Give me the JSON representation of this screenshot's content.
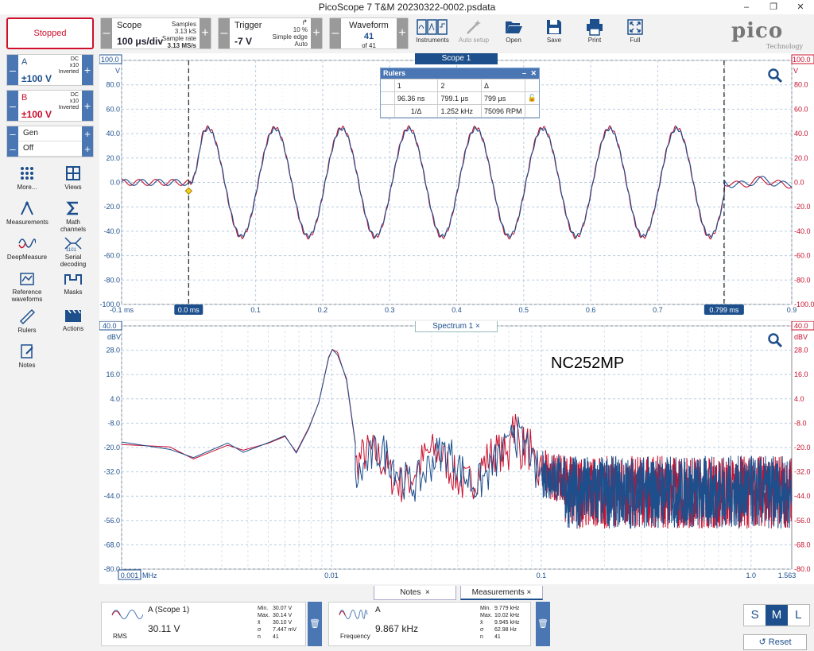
{
  "window": {
    "title": "PicoScope 7 T&M 20230322-0002.psdata"
  },
  "toolbar": {
    "stop_label": "Stopped",
    "scope": {
      "label": "Scope",
      "value": "100 μs/div",
      "samples_label": "Samples",
      "samples": "3.13 kS",
      "rate_label": "Sample rate",
      "rate": "3.13 MS/s"
    },
    "trigger": {
      "label": "Trigger",
      "value": "-7 V",
      "pct": "10 %",
      "type": "Simple edge",
      "mode": "Auto"
    },
    "waveform": {
      "label": "Waveform",
      "value": "41",
      "of": "of 41"
    },
    "tools": [
      "Instruments",
      "Auto setup",
      "Open",
      "Save",
      "Print",
      "Full"
    ],
    "logo_text": "pico",
    "logo_sub": "Technology"
  },
  "channels": {
    "a": {
      "name": "A",
      "range": "±100 V",
      "coupling": "DC",
      "probe": "x10",
      "mode": "Inverted",
      "color": "#1d4f8c"
    },
    "b": {
      "name": "B",
      "range": "±100 V",
      "coupling": "DC",
      "probe": "x10",
      "mode": "Inverted",
      "color": "#c8102e"
    },
    "gen": {
      "name": "Gen",
      "state": "Off"
    }
  },
  "left_tools": [
    {
      "label": "More...",
      "icon": "dots-grid-icon"
    },
    {
      "label": "Views",
      "icon": "views-grid-icon"
    },
    {
      "label": "Measurements",
      "icon": "measurements-icon"
    },
    {
      "label": "Math channels",
      "icon": "sigma-icon"
    },
    {
      "label": "DeepMeasure",
      "icon": "deepmeasure-icon"
    },
    {
      "label": "Serial decoding",
      "icon": "serial-decode-icon"
    },
    {
      "label": "Reference waveforms",
      "icon": "reference-waveform-icon"
    },
    {
      "label": "Masks",
      "icon": "mask-icon"
    },
    {
      "label": "Rulers",
      "icon": "ruler-icon"
    },
    {
      "label": "Actions",
      "icon": "clapper-icon"
    },
    {
      "label": "Notes",
      "icon": "notes-icon"
    }
  ],
  "scope": {
    "tab": "Scope 1",
    "left_unit": "V",
    "right_unit": "V",
    "left_top": "100.0",
    "right_top": "100.0",
    "y_labels": [
      "80.0",
      "60.0",
      "40.0",
      "20.0",
      "0.0",
      "-20.0",
      "-40.0",
      "-60.0",
      "-80.0",
      "-100.0"
    ],
    "x_labels": [
      "-0.1 ms",
      "0.1",
      "0.2",
      "0.3",
      "0.4",
      "0.5",
      "0.6",
      "0.7",
      "0.9"
    ],
    "ruler1_label": "0.0 ms",
    "ruler2_label": "0.799 ms"
  },
  "rulers": {
    "title": "Rulers",
    "h1": "1",
    "h2": "2",
    "hd": "Δ",
    "v1": "96.36 ns",
    "v2": "799.1 μs",
    "vd": "799 μs",
    "inv_label": "1/Δ",
    "freq": "1.252 kHz",
    "rpm": "75096 RPM"
  },
  "spectrum": {
    "tab": "Spectrum 1",
    "left_unit": "dBV",
    "right_unit": "dBV",
    "left_top": "40.0",
    "right_top": "40.0",
    "y_labels": [
      "28.0",
      "16.0",
      "4.0",
      "-8.0",
      "-20.0",
      "-32.0",
      "-44.0",
      "-56.0",
      "-68.0",
      "-80.0"
    ],
    "x_first": "0.001",
    "x_unit": "MHz",
    "x_labels": [
      "0.01",
      "0.1",
      "1.0",
      "1.563"
    ],
    "annotation": "NC252MP"
  },
  "bottom": {
    "tab_notes": "Notes",
    "tab_measurements": "Measurements",
    "m1": {
      "title": "A (Scope 1)",
      "kind": "RMS",
      "value": "30.11 V",
      "min_l": "Min.",
      "min": "30.07 V",
      "max_l": "Max.",
      "max": "30.14 V",
      "mean_l": "x̄",
      "mean": "30.10 V",
      "sd_l": "σ",
      "sd": "7.447 mV",
      "n_l": "n",
      "n": "41"
    },
    "m2": {
      "title": "A",
      "kind": "Frequency",
      "value": "9.867 kHz",
      "min_l": "Min.",
      "min": "9.779 kHz",
      "max_l": "Max.",
      "max": "10.02 kHz",
      "mean_l": "x̄",
      "mean": "9.945 kHz",
      "sd_l": "σ",
      "sd": "62.98 Hz",
      "n_l": "n",
      "n": "41"
    },
    "sizes": [
      "S",
      "M",
      "L"
    ],
    "reset": "Reset"
  }
}
